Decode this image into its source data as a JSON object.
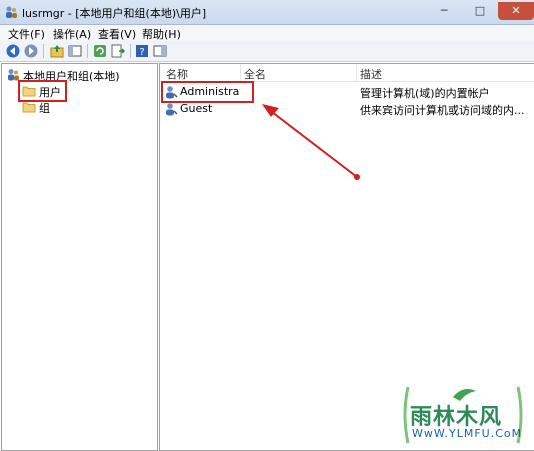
{
  "window": {
    "title": "lusrmgr - [本地用户和组(本地)\\用户]",
    "controls": {
      "minimize": "─",
      "maximize": "□",
      "close": "✕"
    }
  },
  "menu": [
    "文件(F)",
    "操作(A)",
    "查看(V)",
    "帮助(H)"
  ],
  "toolbar": {
    "icons": [
      "back-arrow-icon",
      "forward-arrow-icon",
      "up-folder-icon",
      "show-hide-tree-icon",
      "refresh-icon",
      "export-list-icon",
      "help-icon",
      "properties-pane-icon"
    ]
  },
  "tree": {
    "root": "本地用户和组(本地)",
    "items": [
      {
        "label": "用户",
        "selected": true
      },
      {
        "label": "组",
        "selected": false
      }
    ]
  },
  "list": {
    "columns": [
      "名称",
      "全名",
      "描述"
    ],
    "rows": [
      {
        "name": "Administrat...",
        "fullname": "",
        "description": "管理计算机(域)的内置帐户"
      },
      {
        "name": "Guest",
        "fullname": "",
        "description": "供来宾访问计算机或访问域的内..."
      }
    ]
  },
  "annotation": {
    "color": "#d21f1f"
  },
  "watermark": {
    "brand": "雨林木风",
    "url": "WwW.YLMFU.CoM"
  }
}
